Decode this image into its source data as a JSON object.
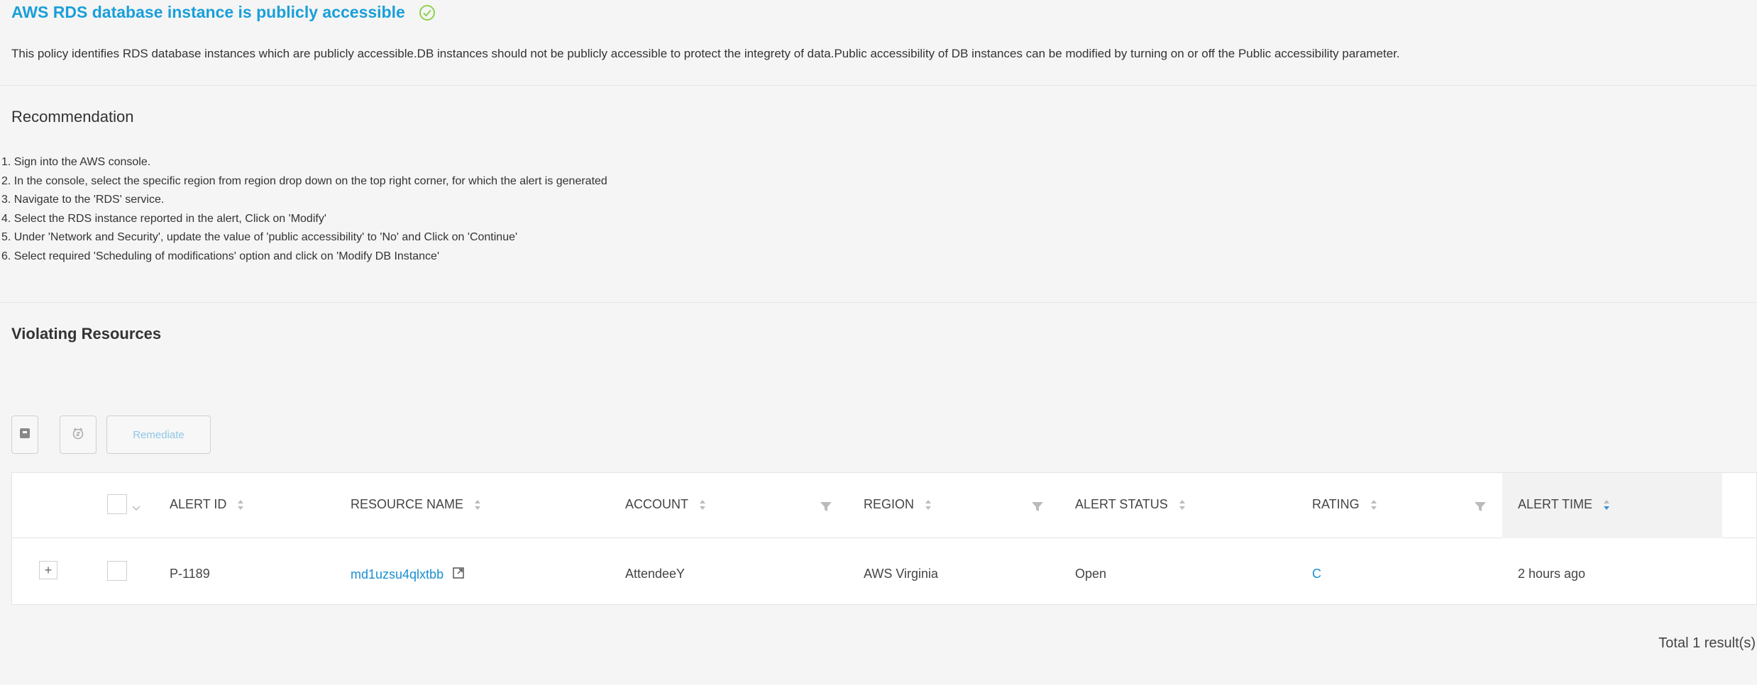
{
  "policy": {
    "title": "AWS RDS database instance is publicly accessible",
    "description": "This policy identifies RDS database instances which are publicly accessible.DB instances should not be publicly accessible to protect the integrety of data.Public accessibility of DB instances can be modified by turning on or off the Public accessibility parameter."
  },
  "recommendation": {
    "heading": "Recommendation",
    "steps": [
      "1. Sign into the AWS console.",
      "2. In the console, select the specific region from region drop down on the top right corner, for which the alert is generated",
      "3. Navigate to the 'RDS' service.",
      "4. Select the RDS instance reported in the alert, Click on 'Modify'",
      "5. Under 'Network and Security', update the value of 'public accessibility' to 'No' and Click on 'Continue'",
      "6. Select required 'Scheduling of modifications' option and click on 'Modify DB Instance'"
    ]
  },
  "violating": {
    "heading": "Violating Resources",
    "remediate_label": "Remediate",
    "columns": {
      "alert_id": "ALERT ID",
      "resource_name": "RESOURCE NAME",
      "account": "ACCOUNT",
      "region": "REGION",
      "alert_status": "ALERT STATUS",
      "rating": "RATING",
      "alert_time": "ALERT TIME"
    },
    "rows": [
      {
        "alert_id": "P-1189",
        "resource_name": "md1uzsu4qlxtbb",
        "account": "AttendeeY",
        "region": "AWS Virginia",
        "alert_status": "Open",
        "rating": "C",
        "alert_time": "2 hours ago"
      }
    ],
    "total": "Total 1 result(s)"
  },
  "colors": {
    "accent": "#1a9fd9",
    "success": "#8fd14f",
    "background": "#f5f5f5"
  },
  "icons": [
    "check-circle-icon",
    "archive-icon",
    "snooze-icon",
    "sort-icon",
    "filter-icon",
    "external-link-icon",
    "expand-icon",
    "chevron-down-icon"
  ]
}
